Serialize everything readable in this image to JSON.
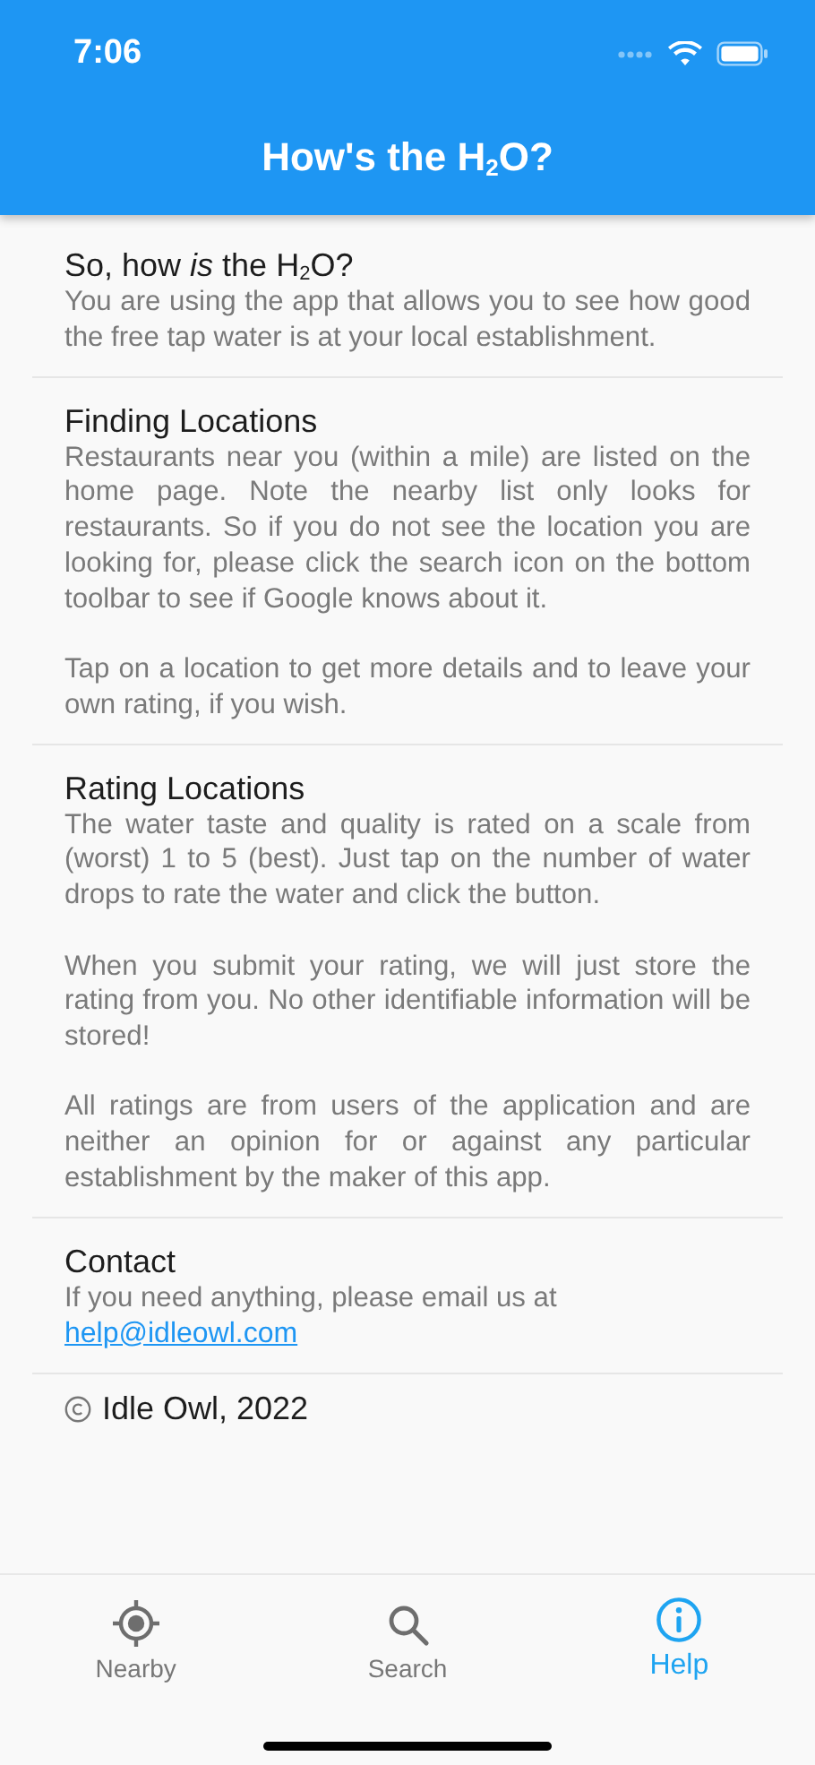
{
  "status_bar": {
    "time": "7:06"
  },
  "app_bar": {
    "title": "How's the H$_{2}$O?"
  },
  "sections": [
    {
      "title": "So, how *is* the H$_{2}$O?",
      "paragraphs": [
        "You are using the app that allows you to see how good the free tap water is at your local establishment."
      ]
    },
    {
      "title": "Finding Locations",
      "paragraphs": [
        "Restaurants near you (within a mile) are listed on the home page. Note the nearby list only looks for restaurants. So if you do not see the location you are looking for, please click the search icon on the bottom toolbar to see if Google knows about it.",
        "Tap on a location to get more details and to leave your own rating, if you wish."
      ]
    },
    {
      "title": "Rating Locations",
      "paragraphs": [
        "The water taste and quality is rated on a scale from (worst) 1 to 5 (best). Just tap on the number of water drops to rate the water and click the button.",
        "When you submit your rating, we will just store the rating from you. No other identifiable information will be stored!",
        "All ratings are from users of the application and are neither an opinion for or against any particular establishment by the maker of this app."
      ]
    },
    {
      "title": "Contact",
      "paragraphs": [
        "If you need anything, please email us at"
      ],
      "link": "help@idleowl.com"
    }
  ],
  "copyright": "Idle Owl, 2022",
  "tabs": [
    {
      "label": "Nearby",
      "selected": false
    },
    {
      "label": "Search",
      "selected": false
    },
    {
      "label": "Help",
      "selected": true
    }
  ]
}
